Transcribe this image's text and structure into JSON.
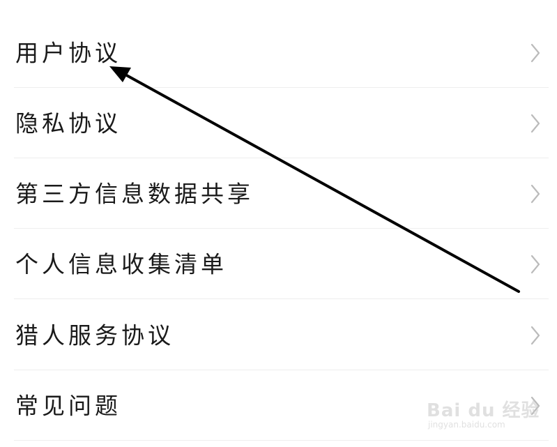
{
  "menu": {
    "items": [
      {
        "label": "用户协议",
        "chevron_icon": "chevron-right-icon"
      },
      {
        "label": "隐私协议",
        "chevron_icon": "chevron-right-icon"
      },
      {
        "label": "第三方信息数据共享",
        "chevron_icon": "chevron-right-icon"
      },
      {
        "label": "个人信息收集清单",
        "chevron_icon": "chevron-right-icon"
      },
      {
        "label": "猎人服务协议",
        "chevron_icon": "chevron-right-icon"
      },
      {
        "label": "常见问题",
        "chevron_icon": "chevron-right-icon"
      }
    ]
  },
  "annotation": {
    "icon": "pointer-arrow-icon",
    "color": "#000000",
    "target": "用户协议"
  },
  "watermark": {
    "main": "Bai du 经验",
    "sub": "jingyan.baidu.com"
  },
  "colors": {
    "text": "#1a1a1a",
    "chevron": "#bbbbbb",
    "divider": "#eeeeee",
    "background": "#ffffff"
  }
}
